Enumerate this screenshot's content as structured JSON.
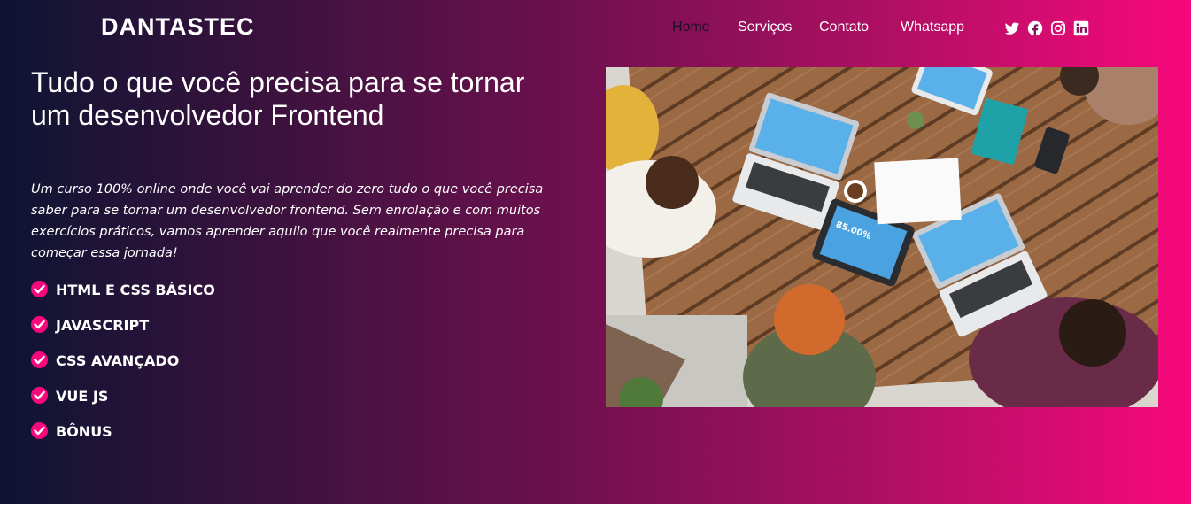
{
  "header": {
    "brand": "DANTASTEC",
    "nav": [
      "Home",
      "Serviços",
      "Contato",
      "Whatsapp"
    ],
    "active_nav": "Home",
    "social_icons": [
      "twitter-icon",
      "facebook-icon",
      "instagram-icon",
      "linkedin-icon"
    ]
  },
  "hero": {
    "title": "Tudo o que você precisa para se tornar um desenvolvedor Frontend",
    "description": "Um curso 100% online onde você vai aprender do zero tudo o que você precisa saber para se tornar um desenvolvedor frontend. Sem enrolação e com muitos exercícios práticos, vamos aprender aquilo que você realmente precisa para começar essa jornada!",
    "features": [
      "HTML E CSS BÁSICO",
      "JAVASCRIPT",
      "CSS AVANÇADO",
      "VUE JS",
      "BÔNUS"
    ],
    "tablet_readout": "85.00%"
  },
  "colors": {
    "gradient_start": "#0e1432",
    "gradient_end": "#f8087c",
    "accent": "#f8087c",
    "active_nav": "#1a0f2a"
  }
}
